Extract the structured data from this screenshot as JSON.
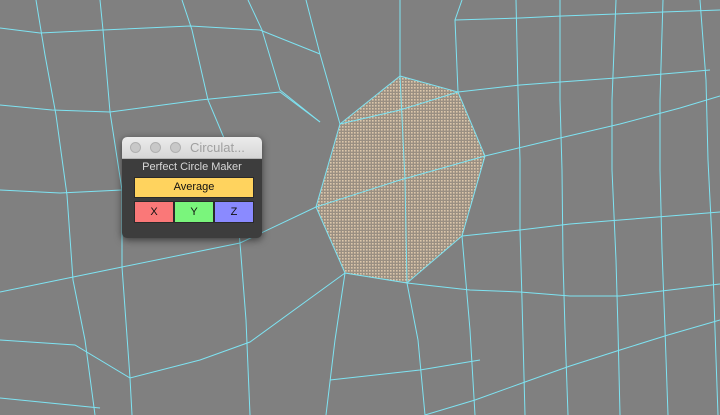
{
  "window": {
    "title": "Circulat..."
  },
  "panel": {
    "heading": "Perfect Circle Maker",
    "average_label": "Average",
    "axis_buttons": [
      "X",
      "Y",
      "Z"
    ]
  },
  "colors": {
    "viewport_bg": "#808080",
    "wire": "#7ee3f2",
    "selected_face": "#b7a58e",
    "average_button": "#ffd35e",
    "x_button": "#fa7878",
    "y_button": "#7af57c",
    "z_button": "#8a8aff"
  }
}
